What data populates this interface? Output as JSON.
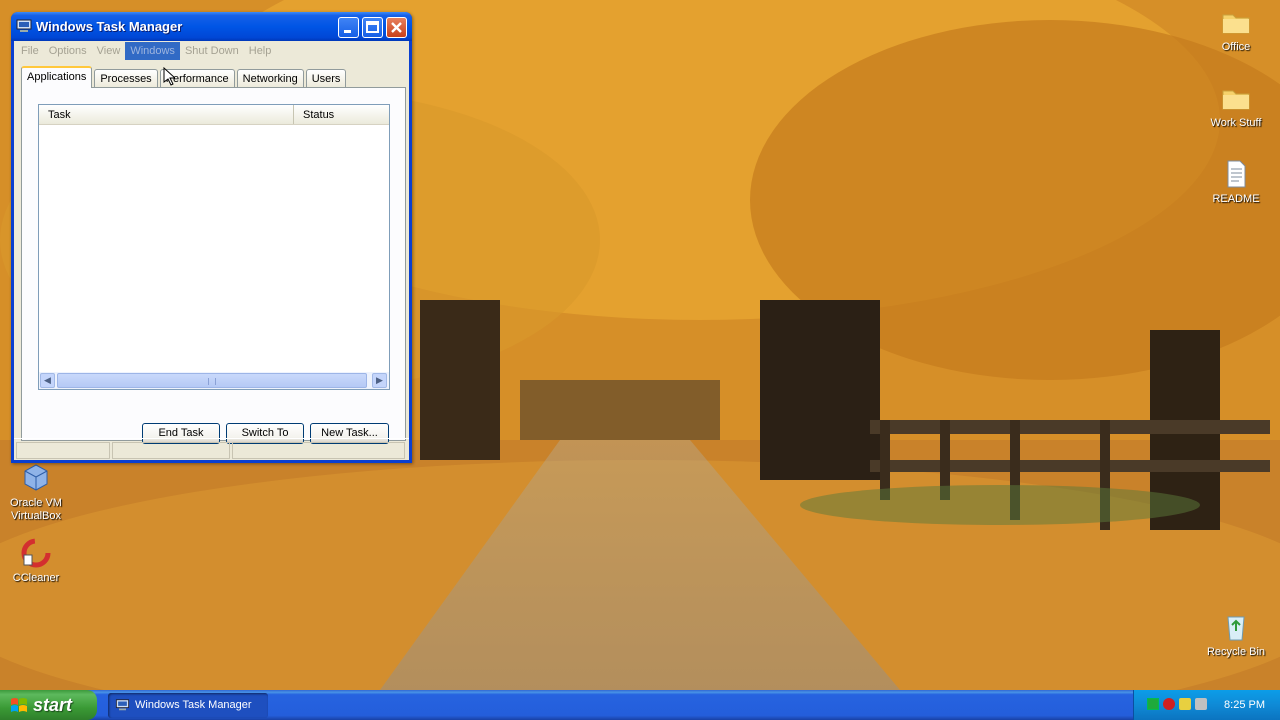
{
  "window": {
    "title": "Windows Task Manager",
    "menu": [
      "File",
      "Options",
      "View",
      "Windows",
      "Shut Down",
      "Help"
    ],
    "active_menu": "Windows",
    "tabs": [
      "Applications",
      "Processes",
      "Performance",
      "Networking",
      "Users"
    ],
    "selected_tab": "Applications",
    "columns": [
      "Task",
      "Status"
    ],
    "buttons": {
      "end_task": "End Task",
      "switch_to": "Switch To",
      "new_task": "New Task..."
    }
  },
  "desktop_icons": {
    "office": "Office",
    "work_stuff": "Work Stuff",
    "readme": "README",
    "virtualbox": "Oracle VM VirtualBox",
    "ccleaner": "CCleaner",
    "recycle_bin": "Recycle Bin"
  },
  "taskbar": {
    "start": "start",
    "task_button": "Windows Task Manager",
    "clock": "8:25 PM"
  },
  "colors": {
    "title_blue": "#0055e5",
    "start_green": "#3a9a35",
    "menu_highlight": "#316ac5",
    "tab_accent": "#ffc83c"
  },
  "icons": [
    "computer-icon",
    "minimize-icon",
    "maximize-icon",
    "close-icon",
    "folder-icon",
    "document-icon",
    "virtualbox-icon",
    "ccleaner-icon",
    "recycle-bin-icon",
    "windows-flag-icon",
    "mouse-cursor-icon"
  ]
}
